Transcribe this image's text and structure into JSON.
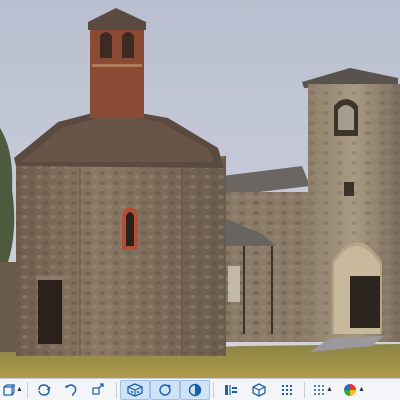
{
  "viewport": {
    "subject": "point-cloud-church"
  },
  "toolbar": {
    "colors": {
      "icon": "#1b5fa8",
      "active_background": "#cfe3f7",
      "active_border": "#9fc2e6"
    },
    "buttons": [
      {
        "icon": "view-cube-icon",
        "has_dropdown": true,
        "active": false
      },
      {
        "icon": "rotate-icon",
        "has_dropdown": false,
        "active": false
      },
      {
        "icon": "orbit-left-icon",
        "has_dropdown": false,
        "active": false
      },
      {
        "icon": "pan-icon",
        "has_dropdown": false,
        "active": false
      },
      {
        "icon": "3d-model-icon",
        "has_dropdown": false,
        "active": true
      },
      {
        "icon": "zoom-refresh-icon",
        "has_dropdown": false,
        "active": true
      },
      {
        "icon": "half-sphere-icon",
        "has_dropdown": false,
        "active": true
      },
      {
        "icon": "section-plane-icon",
        "has_dropdown": false,
        "active": false
      },
      {
        "icon": "box-clip-icon",
        "has_dropdown": false,
        "active": false
      },
      {
        "icon": "point-grid-icon",
        "has_dropdown": false,
        "active": false
      },
      {
        "icon": "point-size-icon",
        "has_dropdown": true,
        "active": false
      },
      {
        "icon": "color-palette-icon",
        "has_dropdown": true,
        "active": false
      }
    ]
  }
}
